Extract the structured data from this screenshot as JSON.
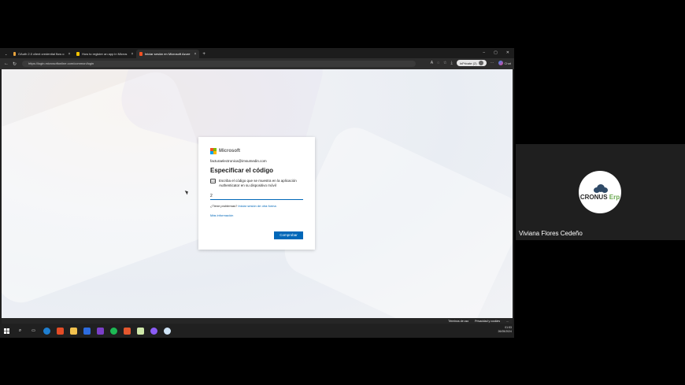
{
  "browser": {
    "tabs": [
      {
        "label": "OAuth 2.0 client credential flow o",
        "color": "#e8a33d",
        "active": false
      },
      {
        "label": "How to register an app in Micros",
        "color": "#f2c200",
        "active": false
      },
      {
        "label": "Iniciar sesión en Microsoft Azure",
        "color": "#f25022",
        "active": true
      }
    ],
    "new_tab": "+",
    "window_controls": [
      "–",
      "▢",
      "✕"
    ],
    "url": "https://login.microsoftonline.com/common/login",
    "inprivate_label": "InPrivate (2)",
    "chat_label": "Chat"
  },
  "signin": {
    "brand": "Microsoft",
    "email": "facturaelectronica@imsumedin.com",
    "title": "Especificar el código",
    "instruction": "Escriba el código que se muestra en la aplicación Authenticator en su dispositivo móvil",
    "instruction_icon": "123",
    "code_value": "2",
    "trouble_prefix": "¿Tiene problemas? ",
    "trouble_link": "Iniciar sesión de otra forma",
    "more_info": "Más información",
    "verify_button": "Comprobar"
  },
  "page_footer": {
    "terms": "Términos de uso",
    "privacy": "Privacidad y cookies",
    "more": "..."
  },
  "taskbar": {
    "time": "01:53",
    "date": "26/05/2024"
  },
  "participant": {
    "name": "Viviana Flores Cedeño",
    "brand_main": "CRONUS",
    "brand_accent": "Erp"
  },
  "colors": {
    "accent": "#0067b8",
    "ms_red": "#f25022",
    "ms_green": "#7fba00",
    "ms_blue": "#00a4ef",
    "ms_yellow": "#ffb900"
  }
}
